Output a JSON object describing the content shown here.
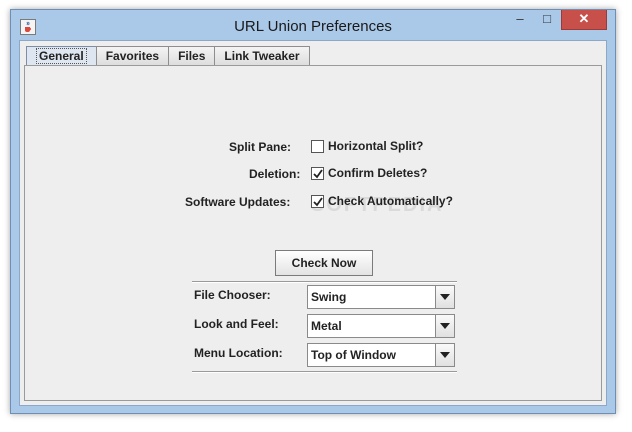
{
  "window": {
    "title": "URL Union Preferences",
    "controls": {
      "minimize": "–",
      "maximize": "□",
      "close": "✕"
    }
  },
  "tabs": [
    {
      "label": "General",
      "active": true
    },
    {
      "label": "Favorites",
      "active": false
    },
    {
      "label": "Files",
      "active": false
    },
    {
      "label": "Link Tweaker",
      "active": false
    }
  ],
  "general": {
    "split_pane": {
      "label": "Split Pane:",
      "option": "Horizontal Split?",
      "checked": false
    },
    "deletion": {
      "label": "Deletion:",
      "option": "Confirm Deletes?",
      "checked": true
    },
    "software_updates": {
      "label": "Software Updates:",
      "option": "Check Automatically?",
      "checked": true
    },
    "check_now_label": "Check Now",
    "file_chooser": {
      "label": "File Chooser:",
      "value": "Swing"
    },
    "look_and_feel": {
      "label": "Look and Feel:",
      "value": "Metal"
    },
    "menu_location": {
      "label": "Menu Location:",
      "value": "Top of Window"
    }
  },
  "watermark": "SOFTPEDIA",
  "icons": {
    "app": "java-cup-icon",
    "check": "checkmark-icon",
    "combo": "triangle-down-icon"
  },
  "colors": {
    "frame": "#aac9e8",
    "close_button": "#c7504a",
    "panel": "#eeeeee"
  }
}
